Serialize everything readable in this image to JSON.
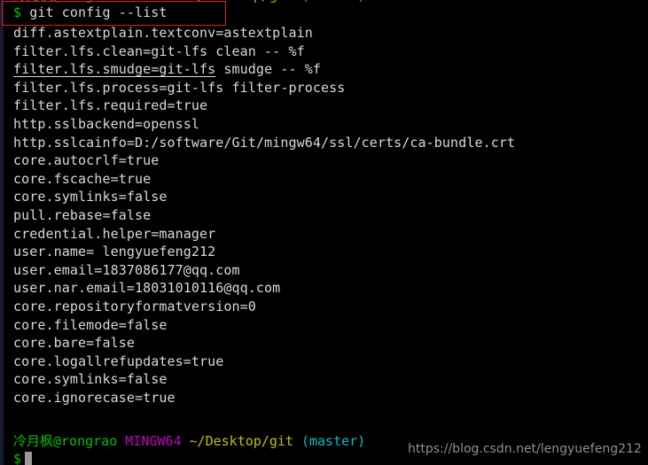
{
  "terminal": {
    "title": "MINGW64 ~/Desktop/git (master)",
    "background_color": "#000000",
    "foreground_color": "#d9d9d9",
    "top_remnant": "previous prompt line (clipped)"
  },
  "command_line": {
    "sigil": "$",
    "command": " git config --list",
    "annotation": "red-rectangle-highlight"
  },
  "output_lines": [
    "diff.astextplain.textconv=astextplain",
    "filter.lfs.clean=git-lfs clean -- %f",
    "filter.lfs.process=git-lfs filter-process",
    "filter.lfs.required=true",
    "http.sslbackend=openssl",
    "http.sslcainfo=D:/software/Git/mingw64/ssl/certs/ca-bundle.crt",
    "core.autocrlf=true",
    "core.fscache=true",
    "core.symlinks=false",
    "pull.rebase=false",
    "credential.helper=manager",
    "user.name= lengyuefeng212",
    "user.email=1837086177@qq.com",
    "user.nar.email=18031010116@qq.com",
    "core.repositoryformatversion=0",
    "core.filemode=false",
    "core.bare=false",
    "core.logallrefupdates=true",
    "core.symlinks=false",
    "core.ignorecase=true"
  ],
  "smudge_line": {
    "underlined_part": "filter.lfs.smudge=git-lfs",
    "rest": " smudge -- %f"
  },
  "prompt": {
    "user_host": "冷月枫@rongrao",
    "shell": "MINGW64",
    "path": "~/Desktop/git",
    "branch": "(master)",
    "sigil": "$",
    "colors": {
      "user_host": "#00c000",
      "shell": "#c000c0",
      "path": "#c0c000",
      "branch": "#00c0c0",
      "sigil": "#00c000"
    }
  },
  "watermark": {
    "text": "https://blog.csdn.net/lengyuefeng212",
    "color": "#8f8f8f"
  },
  "annotation": {
    "box_color": "#e02020"
  }
}
